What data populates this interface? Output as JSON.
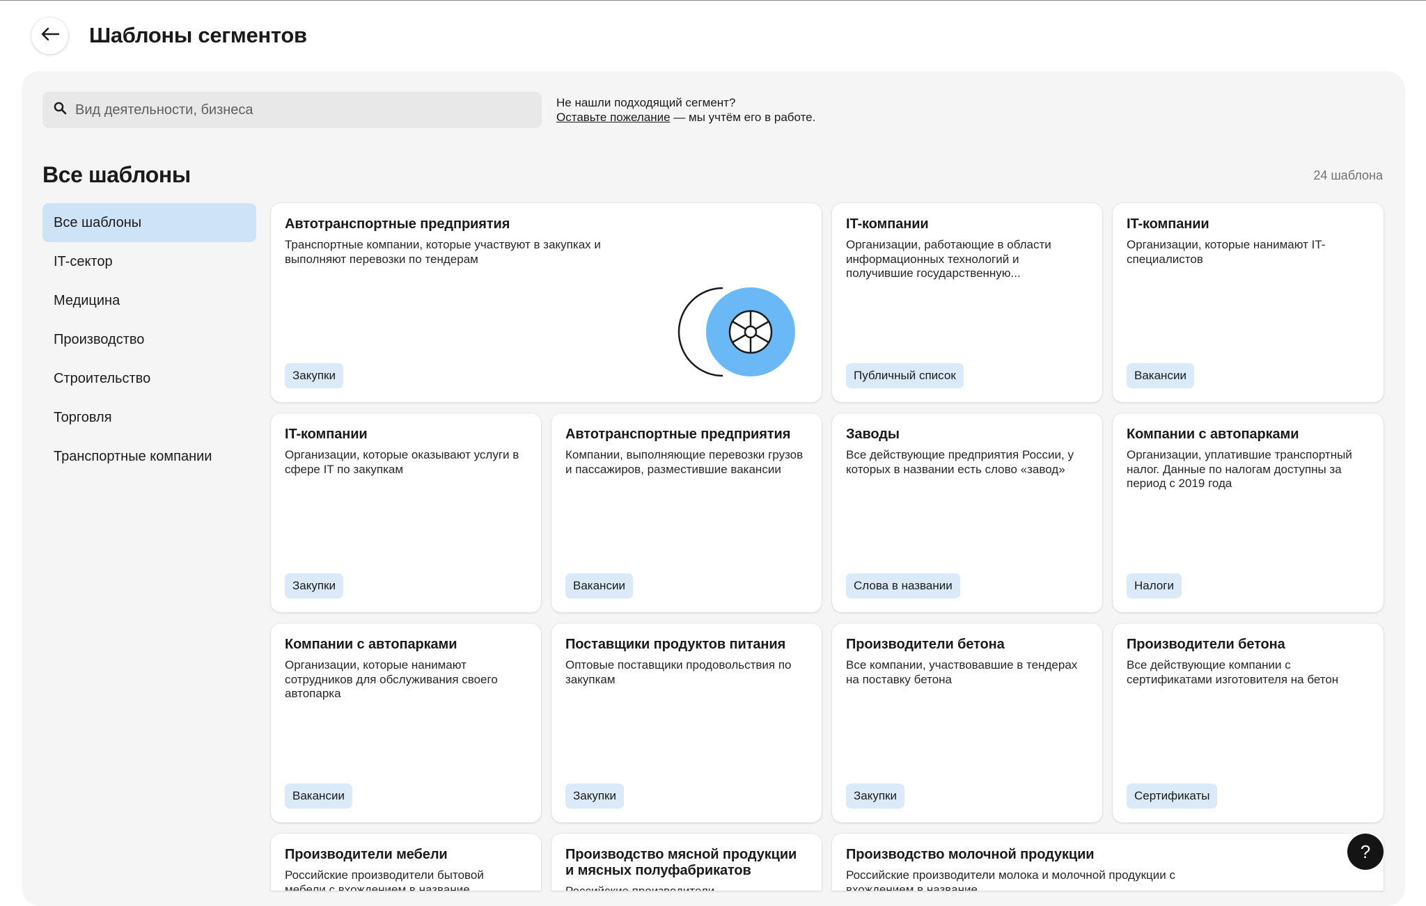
{
  "header": {
    "title": "Шаблоны сегментов"
  },
  "search": {
    "placeholder": "Вид деятельности, бизнеса"
  },
  "hint": {
    "line1": "Не нашли подходящий сегмент?",
    "link": "Оставьте пожелание",
    "rest": " — мы учтём его в работе."
  },
  "section": {
    "title": "Все шаблоны",
    "count": "24 шаблона"
  },
  "sidebar": {
    "items": [
      {
        "label": "Все шаблоны",
        "active": true
      },
      {
        "label": "IT-сектор"
      },
      {
        "label": "Медицина"
      },
      {
        "label": "Производство"
      },
      {
        "label": "Строительство"
      },
      {
        "label": "Торговля"
      },
      {
        "label": "Транспортные компании"
      }
    ]
  },
  "cards": [
    {
      "title": "Автотранспортные предприятия",
      "desc": "Транспортные компании, которые участвуют в закупках и выполняют перевозки по тендерам",
      "tag": "Закупки"
    },
    {
      "title": "IT-компании",
      "desc": "Организации, работающие в области информационных технологий и получившие государственную...",
      "tag": "Публичный список"
    },
    {
      "title": "IT-компании",
      "desc": "Организации, которые нанимают IT-специалистов",
      "tag": "Вакансии"
    },
    {
      "title": "IT-компании",
      "desc": "Организации, которые оказывают услуги в сфере IT по закупкам",
      "tag": "Закупки"
    },
    {
      "title": "Автотранспортные предприятия",
      "desc": "Компании, выполняющие перевозки грузов и пассажиров, разместившие вакансии",
      "tag": "Вакансии"
    },
    {
      "title": "Заводы",
      "desc": "Все действующие предприятия России, у которых в названии есть слово «завод»",
      "tag": "Слова в названии"
    },
    {
      "title": "Компании с автопарками",
      "desc": "Организации, уплатившие транспортный налог. Данные по налогам доступны за период с 2019 года",
      "tag": "Налоги"
    },
    {
      "title": "Компании с автопарками",
      "desc": "Организации, которые нанимают сотрудников для обслуживания своего автопарка",
      "tag": "Вакансии"
    },
    {
      "title": "Поставщики продуктов питания",
      "desc": "Оптовые поставщики продовольствия по закупкам",
      "tag": "Закупки"
    },
    {
      "title": "Производители бетона",
      "desc": "Все компании, участвовавшие в тендерах на поставку бетона",
      "tag": "Закупки"
    },
    {
      "title": "Производители бетона",
      "desc": "Все действующие компании с сертификатами изготовителя на бетон",
      "tag": "Сертификаты"
    },
    {
      "title": "Производители мебели",
      "desc": "Российские производители бытовой мебели с вхождением в название",
      "tag": ""
    },
    {
      "title": "Производство мясной продукции и мясных полуфабрикатов",
      "desc": "Российские производители",
      "tag": ""
    },
    {
      "title": "Производство молочной продукции",
      "desc": "Российские производители молока и молочной продукции с вхождением в название",
      "tag": ""
    }
  ],
  "help": {
    "label": "?"
  }
}
